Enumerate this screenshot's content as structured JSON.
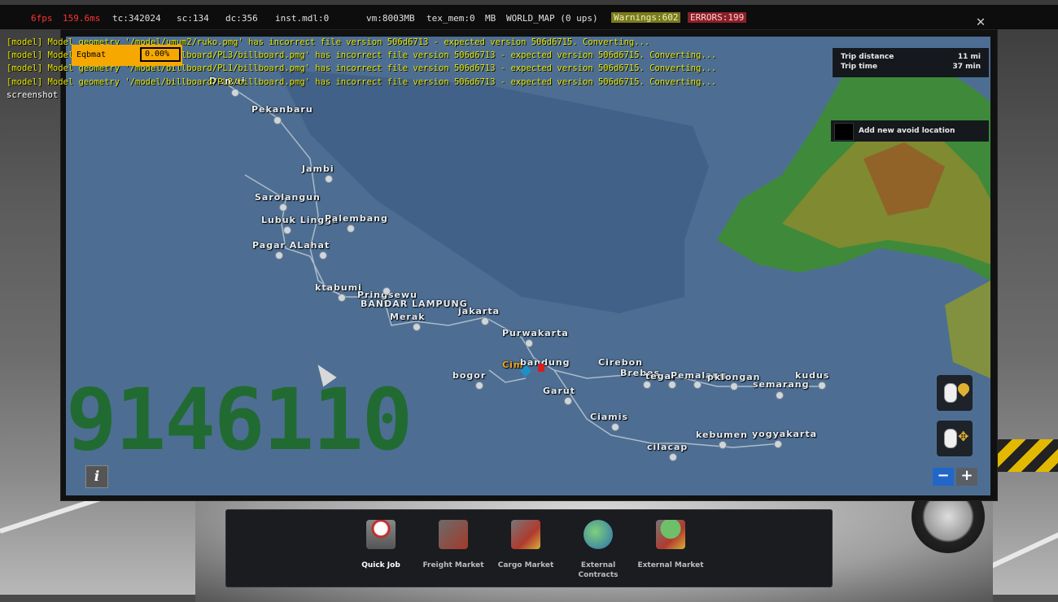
{
  "debug": {
    "fps": "6fps",
    "frame_ms": "159.6ms",
    "tc": "tc:342024",
    "sc": "sc:134",
    "dc": "dc:356",
    "inst": "inst.mdl:0",
    "vm": "vm:8003MB",
    "tex_mem": "tex_mem:0",
    "mb": "MB",
    "mode": "WORLD_MAP (0 ups)",
    "warnings": "Warnings:602",
    "errors": "ERRORS:199"
  },
  "console": {
    "lines": [
      "[model] Model geometry '/model/umum2/ruko.pmg' has incorrect file version 506d6713 - expected version 506d6715. Converting...",
      "[model] Model geometry '/model/billboard/PL3/billboard.pmg' has incorrect file version 506d6713 - expected version 506d6715. Converting...",
      "[model] Model geometry '/model/billboard/PL1/billboard.pmg' has incorrect file version 506d6713 - expected version 506d6715. Converting...",
      "[model] Model geometry '/model/billboard/PL2/billboard.pmg' has incorrect file version 506d6713 - expected version 506d6715. Converting..."
    ],
    "last": "screenshot"
  },
  "overlay_box": {
    "label": "Eqbmat",
    "value": "0.00%"
  },
  "trip": {
    "distance_label": "Trip distance",
    "distance_value": "11 mi",
    "time_label": "Trip time",
    "time_value": "37 min"
  },
  "avoid": {
    "label": "Add new avoid location"
  },
  "overlay_number": "9146110",
  "cities": [
    {
      "name": "Dumai"
    },
    {
      "name": "Pekanbaru"
    },
    {
      "name": "Jambi"
    },
    {
      "name": "Sarolangun"
    },
    {
      "name": "Lubuk Lingga"
    },
    {
      "name": "Palembang"
    },
    {
      "name": "Pagar ALahat"
    },
    {
      "name": "ktabumi"
    },
    {
      "name": "Pringsewu"
    },
    {
      "name": "BANDAR LAMPUNG"
    },
    {
      "name": "jakarta"
    },
    {
      "name": "Merak"
    },
    {
      "name": "Purwakarta"
    },
    {
      "name": "Cim"
    },
    {
      "name": "bandung"
    },
    {
      "name": "Cirebon"
    },
    {
      "name": "Brebes"
    },
    {
      "name": "tegal"
    },
    {
      "name": "Pemalang"
    },
    {
      "name": "pklongan"
    },
    {
      "name": "kudus"
    },
    {
      "name": "semarang"
    },
    {
      "name": "bogor"
    },
    {
      "name": "Garut"
    },
    {
      "name": "Ciamis"
    },
    {
      "name": "kebumen"
    },
    {
      "name": "yogyakarta"
    },
    {
      "name": "cilacap"
    }
  ],
  "controls": {
    "info": "i",
    "zoom_out": "−",
    "zoom_in": "+"
  },
  "nav": [
    {
      "label": "Quick Job",
      "active": true
    },
    {
      "label": "Freight Market",
      "active": false
    },
    {
      "label": "Cargo Market",
      "active": false
    },
    {
      "label": "External Contracts",
      "active": false
    },
    {
      "label": "External Market",
      "active": false
    }
  ],
  "colors": {
    "sea": "#4d6e92",
    "land": "#2f8c3c",
    "console_text": "#e6e600",
    "accent": "#f7a800",
    "route": "#b7c3d0"
  }
}
